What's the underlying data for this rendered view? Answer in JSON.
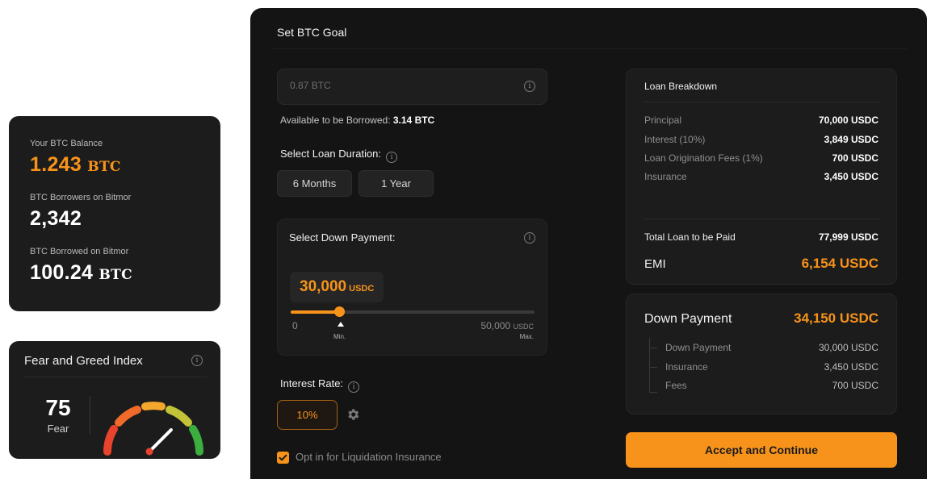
{
  "stats": {
    "balance_label": "Your BTC Balance",
    "balance_value": "1.243",
    "balance_unit": "BTC",
    "borrowers_label": "BTC Borrowers on Bitmor",
    "borrowers_value": "2,342",
    "borrowed_label": "BTC Borrowed on Bitmor",
    "borrowed_value": "100.24",
    "borrowed_unit": "BTC"
  },
  "fear_greed": {
    "title": "Fear and Greed Index",
    "value": "75",
    "label": "Fear",
    "gauge_level": 0.75,
    "info_icon": "info-icon"
  },
  "goal": {
    "title": "Set BTC Goal",
    "amount_placeholder": "0.87 BTC",
    "available_label": "Available to be Borrowed:",
    "available_value": "3.14 BTC",
    "duration_label": "Select Loan Duration:",
    "durations": [
      "6 Months",
      "1 Year"
    ],
    "down_payment_label": "Select Down Payment:",
    "down_payment_value": "30,000",
    "down_payment_unit": "USDC",
    "slider_min_value": "0",
    "slider_max_value": "50,000",
    "slider_max_unit": "USDC",
    "slider_min_label": "Min.",
    "slider_max_label": "Max.",
    "slider_level": 0.2,
    "interest_label": "Interest Rate:",
    "interest_value": "10%",
    "insurance_opt_label": "Opt in for Liquidation Insurance",
    "insurance_opt_checked": true
  },
  "breakdown": {
    "title": "Loan Breakdown",
    "rows": [
      {
        "label": "Principal",
        "value": "70,000 USDC"
      },
      {
        "label": "Interest (10%)",
        "value": "3,849 USDC"
      },
      {
        "label": "Loan Origination Fees (1%)",
        "value": "700 USDC"
      },
      {
        "label": "Insurance",
        "value": "3,450 USDC"
      }
    ],
    "total_label": "Total Loan to be Paid",
    "total_value": "77,999 USDC",
    "emi_label": "EMI",
    "emi_value": "6,154 USDC"
  },
  "down_payment_breakdown": {
    "title": "Down Payment",
    "total": "34,150 USDC",
    "rows": [
      {
        "label": "Down Payment",
        "value": "30,000 USDC"
      },
      {
        "label": "Insurance",
        "value": "3,450 USDC"
      },
      {
        "label": "Fees",
        "value": "700 USDC"
      }
    ]
  },
  "accept_button": "Accept and Continue",
  "colors": {
    "accent": "#f7931a",
    "panel": "#141414",
    "card": "#1c1c1c"
  }
}
